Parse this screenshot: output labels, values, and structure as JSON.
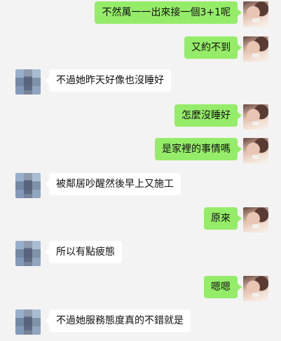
{
  "messages": [
    {
      "sender": "me",
      "text": "不然萬一一出來接一個3+1呢"
    },
    {
      "sender": "me",
      "text": "又約不到"
    },
    {
      "sender": "other",
      "text": "不過她昨天好像也沒睡好"
    },
    {
      "sender": "me",
      "text": "怎麼沒睡好"
    },
    {
      "sender": "me",
      "text": "是家裡的事情嗎"
    },
    {
      "sender": "other",
      "text": "被鄰居吵醒然後早上又施工"
    },
    {
      "sender": "me",
      "text": "原來"
    },
    {
      "sender": "other",
      "text": "所以有點疲態"
    },
    {
      "sender": "me",
      "text": "嗯嗯"
    },
    {
      "sender": "other",
      "text": "不過她服務態度真的不錯就是"
    }
  ],
  "colors": {
    "background": "#f3f3f3",
    "my_bubble": "#95ec69",
    "other_bubble": "#ffffff"
  }
}
